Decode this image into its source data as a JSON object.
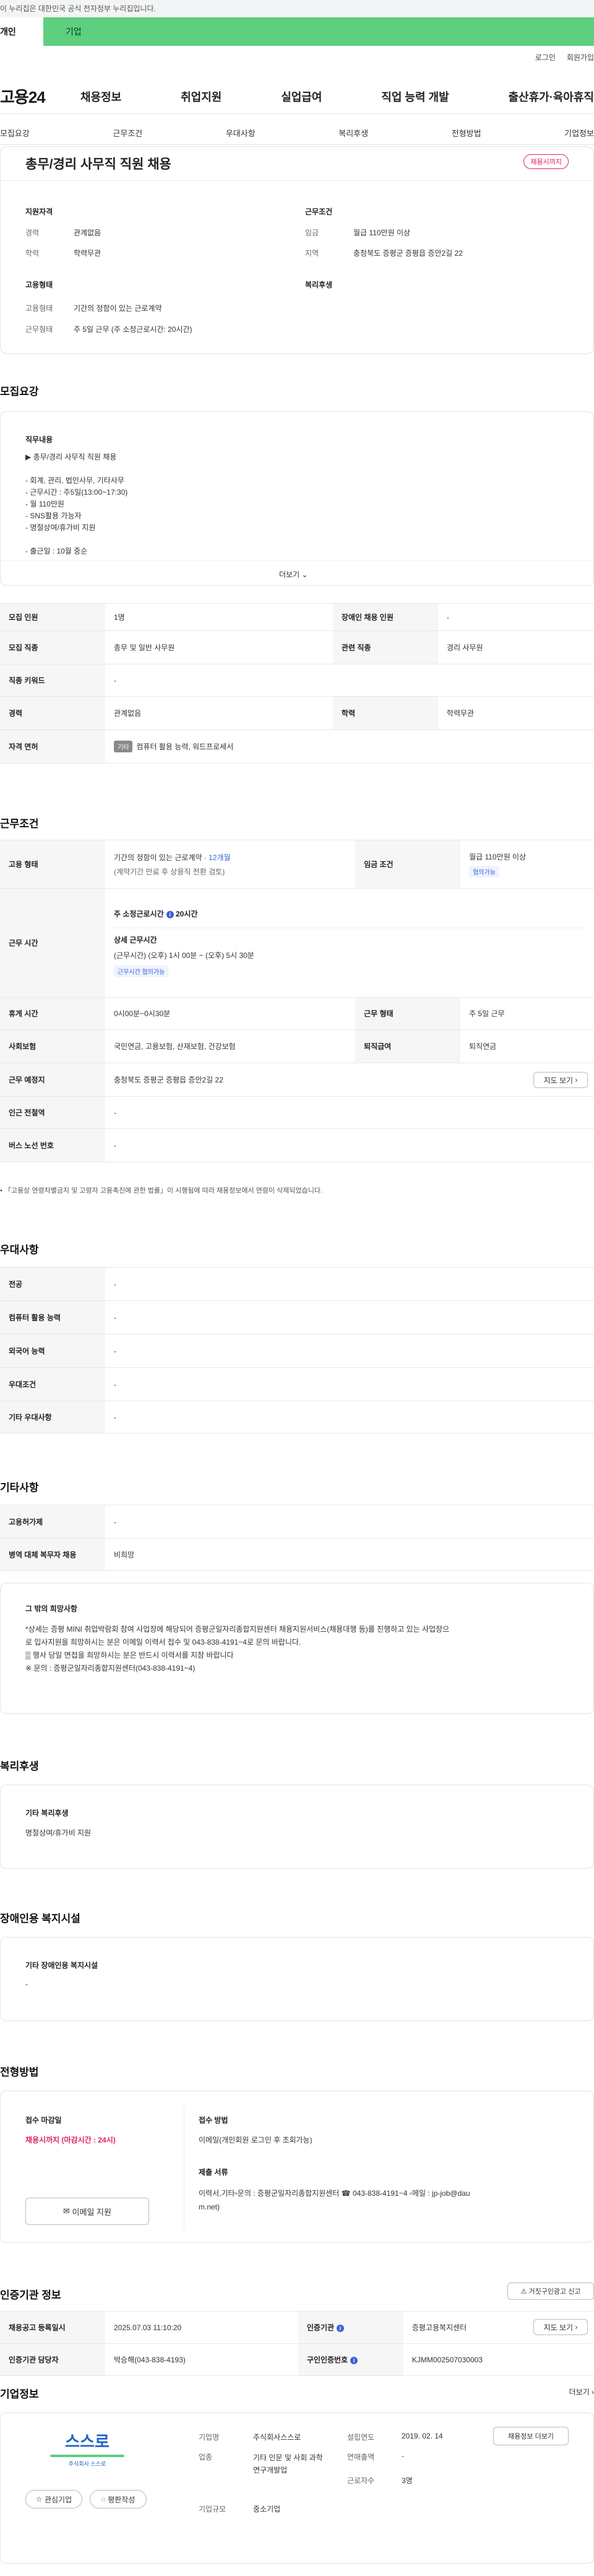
{
  "gov_banner": "이 누리집은 대한민국 공식 전자정부 누리집입니다.",
  "top_tabs": {
    "individual": "개인",
    "business": "기업"
  },
  "util": {
    "login": "로그인",
    "signup": "회원가입"
  },
  "logo": "고용24",
  "gnb": [
    "채용정보",
    "취업지원",
    "실업급여",
    "직업 능력 개발",
    "출산휴가·육아휴직"
  ],
  "anchors": [
    "모집요강",
    "근무조건",
    "우대사항",
    "복리후생",
    "전형방법",
    "기업정보"
  ],
  "summary": {
    "title": "총무/경리 사무직 직원 채용",
    "status_badge": "채용시까지",
    "qual_title": "지원자격",
    "career_label": "경력",
    "career_value": "관계없음",
    "edu_label": "학력",
    "edu_value": "학력무관",
    "work_title": "근무조건",
    "pay_label": "임금",
    "pay_value": "월급 110만원 이상",
    "region_label": "지역",
    "region_value": "충청북도 증평군 증평읍 증안2길 22",
    "emp_title": "고용형태",
    "emptype_label": "고용형태",
    "emptype_value": "기간의 정함이 있는 근로계약",
    "worktype_label": "근무형태",
    "worktype_value": "주 5일 근무 (주 소정근로시간: 20시간)",
    "welfare_title": "복리후생"
  },
  "recruit": {
    "title": "모집요강",
    "content_title": "직무내용",
    "lines": [
      "▶ 총무/경리 사무직 직원 채용",
      "",
      "- 회계, 관리, 법인사무, 기타사무",
      "- 근무시간 : 주5일(13:00~17:30)",
      "- 월 110만원",
      "- SNS활용 가능자",
      "- 명절상여/휴가비 지원",
      "",
      "- 출근일 : 10월 중순"
    ],
    "more": "더보기",
    "rows": [
      [
        "모집 인원",
        "1명",
        "장애인 채용 인원",
        "-"
      ],
      [
        "모집 직종",
        "총무 및 일반 사무원",
        "관련 직종",
        "경리 사무원"
      ],
      [
        "직종 키워드",
        "-",
        "",
        ""
      ],
      [
        "경력",
        "관계없음",
        "학력",
        "학력무관"
      ]
    ],
    "license_label": "자격 면허",
    "license_badge": "기타",
    "license_value": "컴퓨터 활용 능력, 워드프로세서"
  },
  "conditions": {
    "title": "근무조건",
    "emp_label": "고용 형태",
    "emp_value1": "기간의 정함이 있는 근로계약 · ",
    "emp_period": "12개월",
    "emp_value2": "(계약기간 만료 후 상용직 전환 검토)",
    "wage_label": "임금 조건",
    "wage_value": "월급 110만원 이상",
    "wage_pill": "협의가능",
    "hours_label": "근무 시간",
    "weekly_label": "주 소정근로시간",
    "weekly_value": "20시간",
    "detail_title": "상세 근무시간",
    "detail_value": "(근무시간) (오후) 1시 00분 ~ (오후) 5시 30분",
    "hours_pill": "근무시간 협의가능",
    "rows": [
      [
        "휴게 시간",
        "0시00분~0시30분",
        "근무 형태",
        "주 5일 근무"
      ],
      [
        "사회보험",
        "국민연금, 고용보험, 산재보험, 건강보험",
        "퇴직급여",
        "퇴직연금"
      ]
    ],
    "place_label": "근무 예정지",
    "place_value": "충청북도 증평군 증평읍 증안2길 22",
    "map_btn": "지도 보기",
    "station_label": "인근 전철역",
    "station_value": "-",
    "bus_label": "버스 노선 번호",
    "bus_value": "-",
    "note": "「고용상 연령차별금지 및 고령자 고용촉진에 관한 법률」이 시행됨에 따라 채용정보에서 연령이 삭제되었습니다."
  },
  "prefer": {
    "title": "우대사항",
    "rows": [
      [
        "전공",
        "-"
      ],
      [
        "컴퓨터 활용 능력",
        "-"
      ],
      [
        "외국어 능력",
        "-"
      ],
      [
        "우대조건",
        "-"
      ],
      [
        "기타 우대사항",
        "-"
      ]
    ]
  },
  "etc": {
    "title": "기타사항",
    "rows": [
      [
        "고용허가제",
        "-"
      ],
      [
        "병역 대체 복무자 채용",
        "비희망"
      ]
    ],
    "box_title": "그 밖의 희망사항",
    "box_lines": [
      "*상세는 증평 MINI 취업박람회 참여 사업장에 해당되어 증평군일자리종합지원센터 채용지원서비스(채용대행 등)를 진행하고 있는 사업장으",
      "로 입사지원을 희망하시는 분은 이메일 이력서 접수 및 043-838-4191~4로 문의 바랍니다.",
      "▒ 행사 당일 면접을 희망하시는 분은 반드시 이력서를 지참 바랍니다",
      "※ 문의 : 증평군일자리종합지원센터(043-838-4191~4)"
    ]
  },
  "welfare": {
    "title": "복리후생",
    "box_title": "기타 복리후생",
    "box_value": "명절상여/휴가비 지원"
  },
  "disabled": {
    "title": "장애인용 복지시설",
    "box_title": "기타 장애인용 복지시설",
    "box_value": "-"
  },
  "selection": {
    "title": "전형방법",
    "deadline_title": "접수 마감일",
    "deadline_value": "채용시까지 (마감시간 : 24시)",
    "method_title": "접수 방법",
    "method_value": "이메일(개인회원 로그인 후 조회가능)",
    "docs_title": "제출 서류",
    "docs_value1": "이력서,기타▫문의 : 증평군일자리종합지원센터 ☎ 043-838-4191~4 ▫메일 : jp-job@dau",
    "docs_value2": "m.net)",
    "email_btn": "이메일 지원"
  },
  "agency": {
    "title": "인증기관 정보",
    "report_btn": "거짓구인광고 신고",
    "rows": [
      [
        "채용공고 등록일시",
        "2025.07.03 11:10:20",
        "인증기관",
        "증평고용복지센터"
      ],
      [
        "인증기관 담당자",
        "박승해(043-838-4193)",
        "구인인증번호",
        "KJMM002507030003"
      ]
    ],
    "map_btn": "지도 보기"
  },
  "company": {
    "title": "기업정보",
    "more": "더보기",
    "logo_text": "스스로",
    "logo_sub": "주식회사 스스로",
    "fav_btn": "관심기업",
    "review_btn": "평판작성",
    "rows": [
      [
        "기업명",
        "주식회사스스로",
        "설립연도",
        "2019. 02. 14"
      ],
      [
        "업종",
        "기타 인문 및 사회 과학 연구개발업",
        "연매출액",
        "-"
      ],
      [
        "기업규모",
        "중소기업",
        "근로자수",
        "3명"
      ]
    ],
    "jobs_btn": "채용정보 더보기"
  },
  "colors": {
    "brand_green": "#5dcf7f",
    "alert_red": "#e0245e",
    "accent_blue": "#3a63d8"
  }
}
